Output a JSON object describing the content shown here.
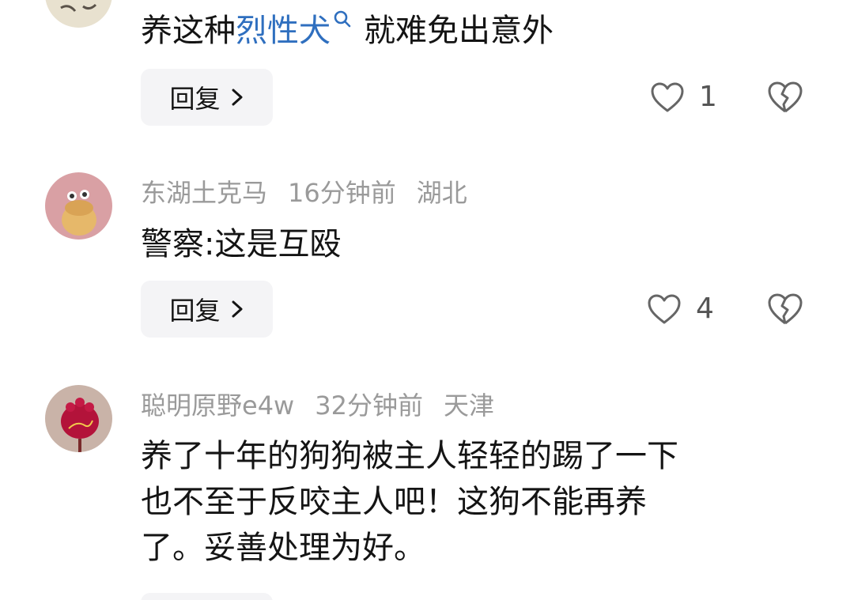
{
  "colors": {
    "keyword": "#2f6fbf",
    "meta_text": "#9a9a9a",
    "body_text": "#141414",
    "button_bg": "#f4f4f6"
  },
  "comments": [
    {
      "text_before": "养这种",
      "keyword": "烈性犬",
      "text_after": "就难免出意外",
      "reply_label": "回复",
      "likes": "1"
    },
    {
      "username": "东湖土克马",
      "time": "16分钟前",
      "location": "湖北",
      "text_lines": [
        "警察:这是互殴"
      ],
      "reply_label": "回复",
      "likes": "4"
    },
    {
      "username": "聪明原野e4w",
      "time": "32分钟前",
      "location": "天津",
      "text_lines": [
        "养了十年的狗狗被主人轻轻的踢了一下",
        "也不至于反咬主人吧！这狗不能再养",
        "了。妥善处理为好。"
      ]
    }
  ],
  "icons": {
    "like": "heart-outline-icon",
    "dislike": "broken-heart-icon",
    "reply_arrow": "chevron-right-icon",
    "keyword_search": "search-icon"
  }
}
